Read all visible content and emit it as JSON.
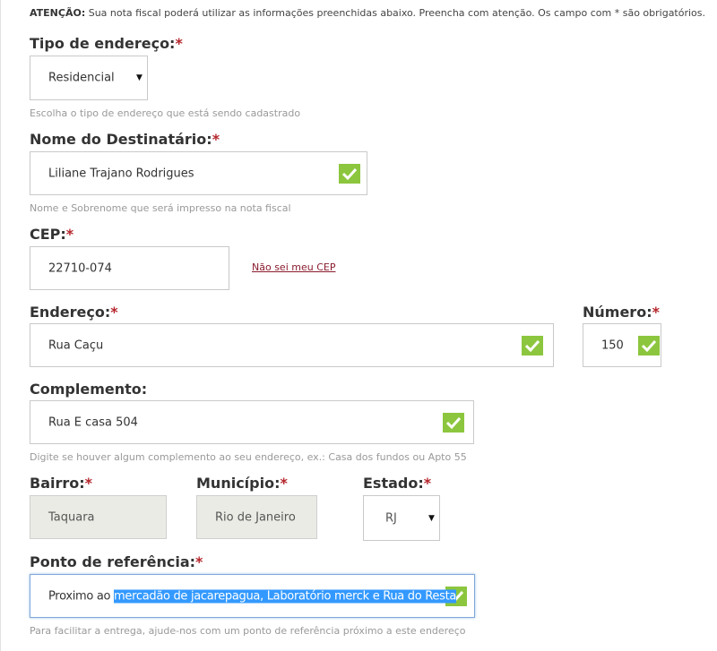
{
  "notice": {
    "prefix": "ATENÇÃO:",
    "text": "Sua nota fiscal poderá utilizar as informações preenchidas abaixo. Preencha com atenção. Os campo com * são obrigatórios."
  },
  "required_marker": "*",
  "tipo": {
    "label": "Tipo de endereço:",
    "value": "Residencial",
    "help": "Escolha o tipo de endereço que está sendo cadastrado"
  },
  "nome": {
    "label": "Nome do Destinatário:",
    "value": "Liliane Trajano Rodrigues",
    "help": "Nome e Sobrenome que será impresso na nota fiscal"
  },
  "cep": {
    "label": "CEP:",
    "value": "22710-074",
    "link": "Não sei meu CEP"
  },
  "endereco": {
    "label": "Endereço:",
    "value": "Rua Caçu"
  },
  "numero": {
    "label": "Número:",
    "value": "150"
  },
  "complemento": {
    "label": "Complemento:",
    "value": "Rua E casa 504",
    "help": "Digite se houver algum complemento ao seu endereço, ex.: Casa dos fundos ou Apto 55"
  },
  "bairro": {
    "label": "Bairro:",
    "value": "Taquara"
  },
  "municipio": {
    "label": "Município:",
    "value": "Rio de Janeiro"
  },
  "estado": {
    "label": "Estado:",
    "value": "RJ"
  },
  "referencia": {
    "label": "Ponto de referência:",
    "value_unselected": "Proximo ao ",
    "value_selected": "mercadão de jacarepagua, Laboratório merck e Rua do Resta",
    "help": "Para facilitar a entrega, ajude-nos com um ponto de referência próximo a este endereço"
  },
  "colors": {
    "check_green": "#8cc63e",
    "required_red": "#b4262c",
    "link": "#8a1c2e",
    "selection": "#3399ff"
  },
  "icons": {
    "valid": "checkmark-icon",
    "dropdown": "caret-down-icon"
  }
}
